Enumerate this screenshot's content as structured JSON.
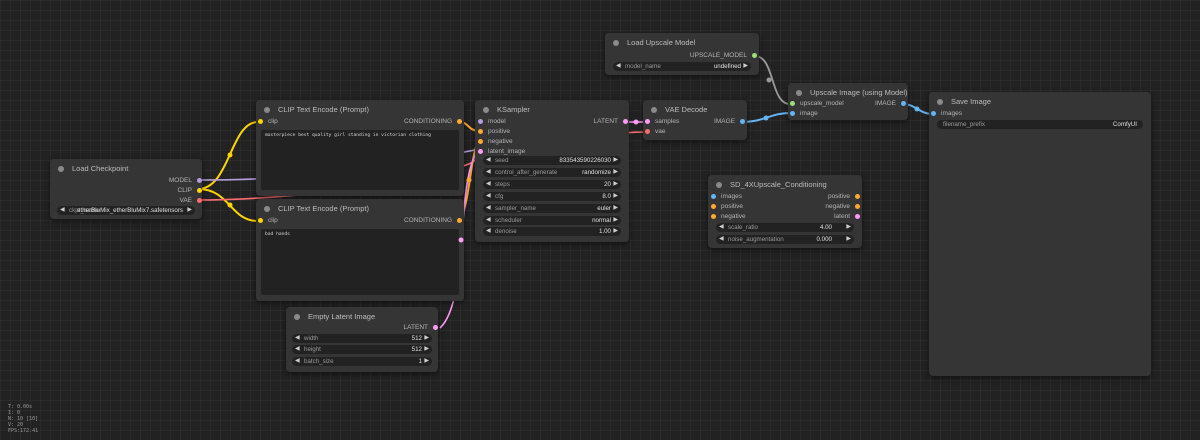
{
  "colors": {
    "clip": "#ffd500",
    "conditioning": "#ffa931",
    "model": "#b39ddb",
    "vae": "#ff6e6e",
    "latent": "#ff9cf9",
    "image": "#64b5f6",
    "upscale_model": "#9de07a"
  },
  "nodes": {
    "load_checkpoint": {
      "title": "Load Checkpoint",
      "outputs": [
        "MODEL",
        "CLIP",
        "VAE"
      ],
      "widget_name": "ckpt_name",
      "widget_value": "etherBluMix_etherBluMix7.safetensors"
    },
    "clip_pos": {
      "title": "CLIP Text Encode (Prompt)",
      "input": "clip",
      "output": "CONDITIONING",
      "text": "masterpiece best quality girl standing in victorian clothing"
    },
    "clip_neg": {
      "title": "CLIP Text Encode (Prompt)",
      "input": "clip",
      "output": "CONDITIONING",
      "text": "bad hands"
    },
    "empty_latent": {
      "title": "Empty Latent Image",
      "output": "LATENT",
      "widgets": [
        {
          "name": "width",
          "value": "512"
        },
        {
          "name": "height",
          "value": "512"
        },
        {
          "name": "batch_size",
          "value": "1"
        }
      ]
    },
    "ksampler": {
      "title": "KSampler",
      "inputs": [
        "model",
        "positive",
        "negative",
        "latent_image"
      ],
      "output": "LATENT",
      "widgets": [
        {
          "name": "seed",
          "value": "833543590226030"
        },
        {
          "name": "control_after_generate",
          "value": "randomize"
        },
        {
          "name": "steps",
          "value": "20"
        },
        {
          "name": "cfg",
          "value": "8.0"
        },
        {
          "name": "sampler_name",
          "value": "euler"
        },
        {
          "name": "scheduler",
          "value": "normal"
        },
        {
          "name": "denoise",
          "value": "1.00"
        }
      ]
    },
    "vae_decode": {
      "title": "VAE Decode",
      "inputs": [
        "samples",
        "vae"
      ],
      "output": "IMAGE"
    },
    "load_upscale": {
      "title": "Load Upscale Model",
      "output": "UPSCALE_MODEL",
      "widget_name": "model_name",
      "widget_value": "undefined"
    },
    "upscale_image": {
      "title": "Upscale Image (using Model)",
      "inputs": [
        "upscale_model",
        "image"
      ],
      "output": "IMAGE"
    },
    "save_image": {
      "title": "Save Image",
      "input": "images",
      "widget_name": "filename_prefix",
      "widget_value": "ComfyUI"
    },
    "sd4x": {
      "title": "SD_4XUpscale_Conditioning",
      "inputs": [
        "images",
        "positive",
        "negative"
      ],
      "outputs": [
        "positive",
        "negative",
        "latent"
      ],
      "widgets": [
        {
          "name": "scale_ratio",
          "value": "4.00"
        },
        {
          "name": "noise_augmentation",
          "value": "0.000"
        }
      ]
    }
  },
  "stats": [
    "T: 0.00s",
    "I: 0",
    "N: 10 [10]",
    "V: 20",
    "FPS:172.41"
  ]
}
